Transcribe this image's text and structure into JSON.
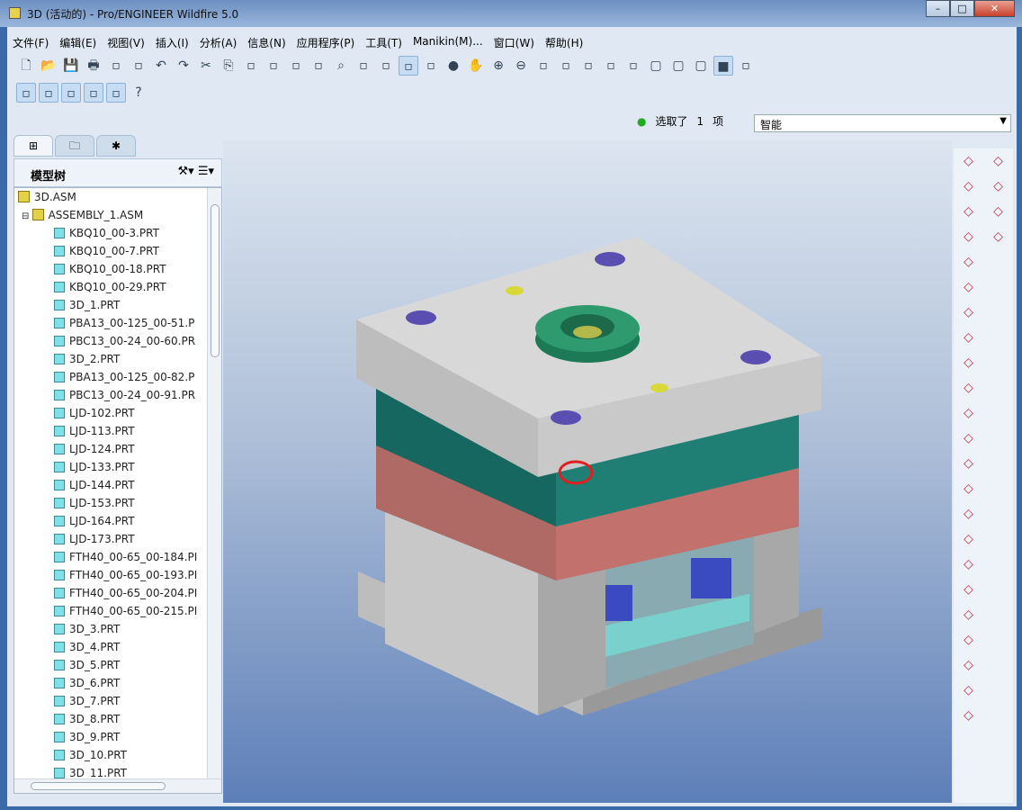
{
  "window": {
    "title": "3D (活动的) - Pro/ENGINEER Wildfire 5.0",
    "minimize": "–",
    "maximize": "□",
    "close": "✕"
  },
  "menu": [
    "文件(F)",
    "编辑(E)",
    "视图(V)",
    "插入(I)",
    "分析(A)",
    "信息(N)",
    "应用程序(P)",
    "工具(T)",
    "Manikin(M)...",
    "窗口(W)",
    "帮助(H)"
  ],
  "toolbar1": [
    "new-icon",
    "open-icon",
    "save-icon",
    "print-icon",
    "email-icon",
    "email-link-icon",
    "undo-icon",
    "redo-icon",
    "cut-icon",
    "copy-icon",
    "paste-icon",
    "paste-special-icon",
    "regenerate-icon",
    "regen-manager-icon",
    "find-icon",
    "select-box-icon",
    "redraw-icon",
    "spin-center-icon",
    "orient-icon",
    "appearance-icon",
    "pan-icon",
    "zoom-in-icon",
    "zoom-out-icon",
    "refit-icon",
    "reorient-icon",
    "saved-views-icon",
    "layers-icon",
    "view-manager-icon",
    "wireframe-icon",
    "hidden-line-icon",
    "no-hidden-icon",
    "shading-icon",
    "spotlight-icon"
  ],
  "toolbar2": [
    "datum-plane-display-icon",
    "datum-axis-display-icon",
    "point-display-icon",
    "csys-display-icon",
    "annotation-display-icon",
    "context-help-icon"
  ],
  "status": {
    "selected_label": "选取了",
    "selected_count": "1",
    "selected_unit": "项",
    "filter_value": "智能"
  },
  "model_tree": {
    "header": "模型树",
    "root": "3D.ASM",
    "assembly": "ASSEMBLY_1.ASM",
    "items": [
      "KBQ10_00-3.PRT",
      "KBQ10_00-7.PRT",
      "KBQ10_00-18.PRT",
      "KBQ10_00-29.PRT",
      "3D_1.PRT",
      "PBA13_00-125_00-51.P",
      "PBC13_00-24_00-60.PR",
      "3D_2.PRT",
      "PBA13_00-125_00-82.P",
      "PBC13_00-24_00-91.PR",
      "LJD-102.PRT",
      "LJD-113.PRT",
      "LJD-124.PRT",
      "LJD-133.PRT",
      "LJD-144.PRT",
      "LJD-153.PRT",
      "LJD-164.PRT",
      "LJD-173.PRT",
      "FTH40_00-65_00-184.PI",
      "FTH40_00-65_00-193.PI",
      "FTH40_00-65_00-204.PI",
      "FTH40_00-65_00-215.PI",
      "3D_3.PRT",
      "3D_4.PRT",
      "3D_5.PRT",
      "3D_6.PRT",
      "3D_7.PRT",
      "3D_8.PRT",
      "3D_9.PRT",
      "3D_10.PRT",
      "3D_11.PRT"
    ]
  },
  "colors": {
    "top_plate": "#d4d4d4",
    "cavity": "#1f7a70",
    "core": "#b86a66",
    "bottom": "#c8c8c8",
    "sprue": "#2e9a6e",
    "bolt": "#5a4fb0"
  }
}
